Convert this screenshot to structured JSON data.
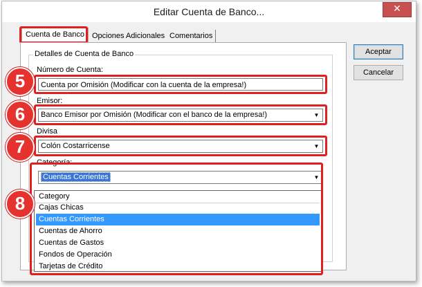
{
  "window": {
    "title": "Editar Cuenta de Banco...",
    "close_glyph": "✕"
  },
  "tabs": [
    {
      "label": "Cuenta de Banco",
      "active": true
    },
    {
      "label": "Opciones Adicionales",
      "active": false
    },
    {
      "label": "Comentarios",
      "active": false
    }
  ],
  "group": {
    "legend": "Detalles de Cuenta de Banco"
  },
  "fields": {
    "account_number": {
      "label": "Número de Cuenta:",
      "value": "Cuenta por Omisión (Modificar con la cuenta de la empresa!)"
    },
    "issuer": {
      "label": "Emisor:",
      "value": "Banco Emisor por Omisión (Modificar con el banco de la empresa!)"
    },
    "currency": {
      "label": "Divisa",
      "value": "Colón Costarricense"
    },
    "category": {
      "label": "Categoría:",
      "value": "Cuentas Corrientes"
    }
  },
  "category_dropdown": {
    "header": "Category",
    "options": [
      "Cajas Chicas",
      "Cuentas Corrientes",
      "Cuentas de Ahorro",
      "Cuentas de Gastos",
      "Fondos de Operación",
      "Tarjetas de Crédito"
    ],
    "selected": "Cuentas Corrientes"
  },
  "buttons": {
    "accept": "Aceptar",
    "cancel": "Cancelar"
  },
  "callouts": [
    "5",
    "6",
    "7",
    "8"
  ],
  "colors": {
    "callout_red": "#e6322e",
    "highlight_box": "#e02020",
    "selection": "#3399ff"
  },
  "icons": {
    "dropdown_arrow": "▼"
  }
}
